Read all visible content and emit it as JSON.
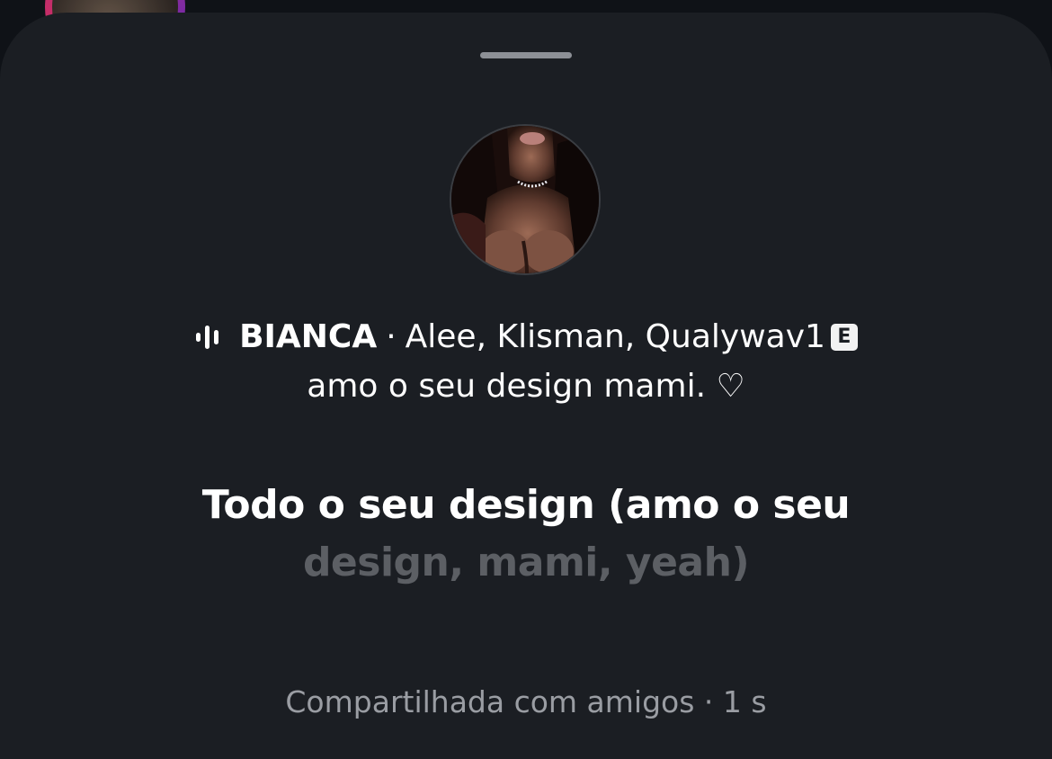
{
  "story": {
    "artist": "BIANCA",
    "separator": "·",
    "collaborators": "Alee, Klisman, Qualywav1",
    "explicit_badge": "E",
    "note": "amo o seu design mami. ♡",
    "lyrics": {
      "sung": "Todo o seu design (amo o seu ",
      "upcoming": "design, mami, yeah)"
    },
    "footer": {
      "shared": "Compartilhada com amigos",
      "separator": "·",
      "time": "1 s"
    }
  },
  "icons": {
    "audio": "audio-waveform-icon",
    "avatar": "profile-avatar"
  },
  "colors": {
    "sheet_background": "#1b1e23",
    "text_primary": "#ffffff",
    "text_secondary": "#9a9da3",
    "lyrics_dim": "#5c5f64"
  }
}
